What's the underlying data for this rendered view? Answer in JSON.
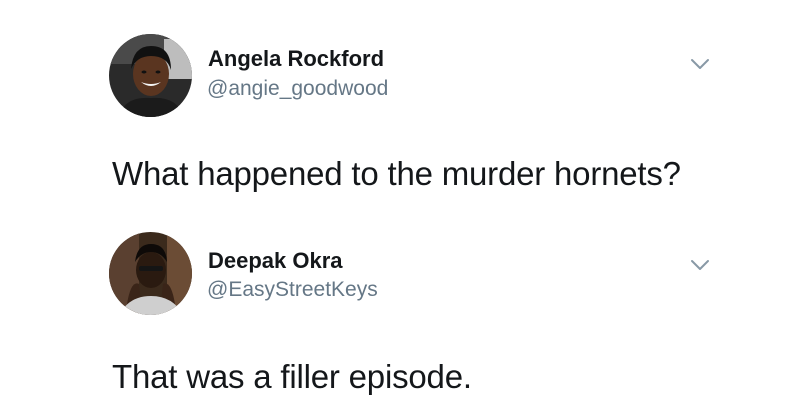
{
  "tweets": [
    {
      "display_name": "Angela Rockford",
      "handle": "@angie_goodwood",
      "text": "What happened to the murder hornets?",
      "avatar_icon": "profile-photo",
      "menu_icon": "chevron-down-icon"
    },
    {
      "display_name": "Deepak Okra",
      "handle": "@EasyStreetKeys",
      "text": "That was a filler episode.",
      "avatar_icon": "profile-photo",
      "menu_icon": "chevron-down-icon"
    }
  ],
  "colors": {
    "text_primary": "#14171a",
    "text_secondary": "#657786",
    "chevron": "#8899a6",
    "background": "#ffffff"
  }
}
